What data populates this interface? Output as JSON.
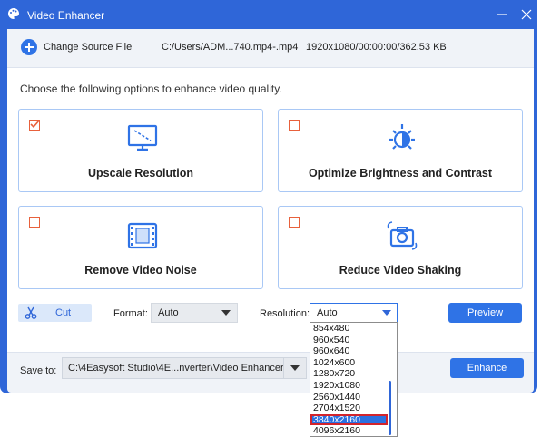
{
  "window": {
    "title": "Video Enhancer",
    "icons": {
      "app": "palette-icon",
      "minimize": "minimize-icon",
      "close": "close-icon"
    },
    "accent": "#2f66d8"
  },
  "source": {
    "change_label": "Change Source File",
    "path": "C:/Users/ADM...740.mp4-.mp4",
    "info": "1920x1080/00:00:00/362.53 KB"
  },
  "intro": "Choose the following options to enhance video quality.",
  "options": [
    {
      "label": "Upscale Resolution",
      "checked": true,
      "icon": "upscale-monitor-icon"
    },
    {
      "label": "Optimize Brightness and Contrast",
      "checked": false,
      "icon": "brightness-icon"
    },
    {
      "label": "Remove Video Noise",
      "checked": false,
      "icon": "film-noise-icon"
    },
    {
      "label": "Reduce Video Shaking",
      "checked": false,
      "icon": "shaking-camera-icon"
    }
  ],
  "toolbar": {
    "cut_label": "Cut",
    "format_label": "Format:",
    "format_value": "Auto",
    "resolution_label": "Resolution:",
    "resolution_value": "Auto",
    "preview_label": "Preview"
  },
  "resolution_options": [
    "854x480",
    "960x540",
    "960x640",
    "1024x600",
    "1280x720",
    "1920x1080",
    "2560x1440",
    "2704x1520",
    "3840x2160",
    "4096x2160"
  ],
  "resolution_highlighted": "3840x2160",
  "footer": {
    "save_label": "Save to:",
    "save_path": "C:\\4Easysoft Studio\\4E...nverter\\Video Enhancer",
    "enhance_label": "Enhance"
  }
}
